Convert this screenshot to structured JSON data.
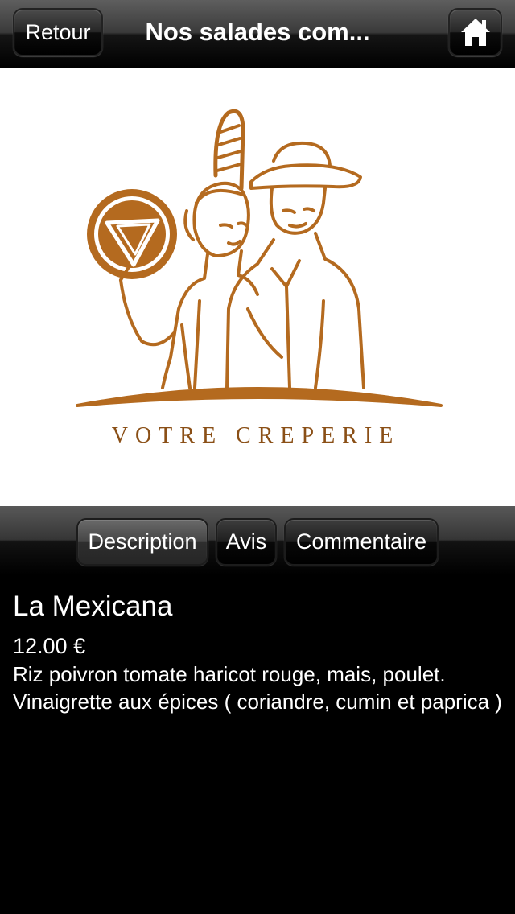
{
  "navbar": {
    "back_label": "Retour",
    "title": "Nos salades com...",
    "home_icon": "home-icon"
  },
  "hero": {
    "brand_text": "VOTRE CREPERIE",
    "brand_color": "#b46a1f"
  },
  "tabs": [
    {
      "label": "Description",
      "active": true
    },
    {
      "label": "Avis",
      "active": false
    },
    {
      "label": "Commentaire",
      "active": false
    }
  ],
  "item": {
    "name": "La Mexicana",
    "price": "12.00 €",
    "description": "Riz poivron tomate haricot rouge, mais, poulet. Vinaigrette aux épices ( coriandre, cumin et paprica )"
  }
}
